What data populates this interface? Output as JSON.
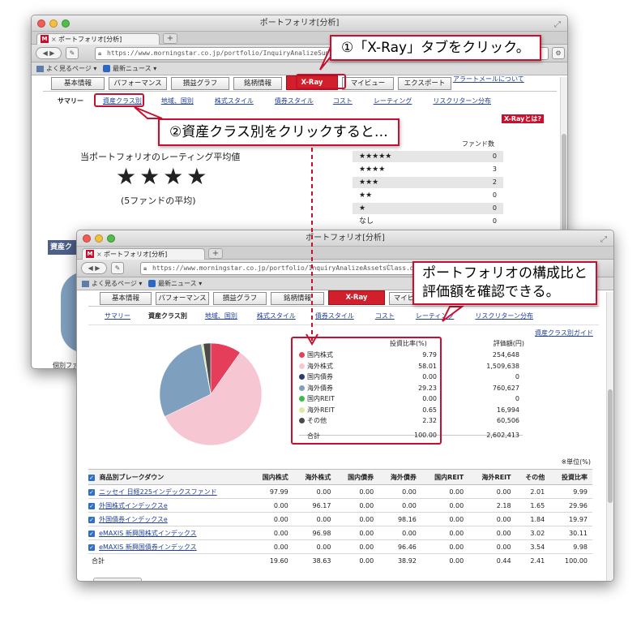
{
  "back_window": {
    "title": "ポートフォリオ[分析]",
    "tab_label": "ポートフォリオ[分析]",
    "url": "https://www.morningstar.co.jp/portfolio/InquiryAnalizeSummary.do",
    "bookmarks": [
      "よく見るページ ▾",
      "最新ニュース ▾"
    ],
    "main_tabs": [
      "基本情報",
      "パフォーマンス",
      "損益グラフ",
      "銘柄情報",
      "X-Ray",
      "マイビュー",
      "エクスポート"
    ],
    "alert_link": "アラートメールについて",
    "sub_tabs": [
      "サマリー",
      "資産クラス別",
      "地域、国別",
      "株式スタイル",
      "債券スタイル",
      "コスト",
      "レーティング",
      "リスクリターン分布"
    ],
    "xray_help": "X-Rayとは?",
    "rating_title": "当ポートフォリオのレーティング平均値",
    "rating_stars": "★★★★",
    "rating_note": "(5ファンドの平均)",
    "fund_count_header": "ファンド数",
    "rating_rows": [
      {
        "stars": "★★★★★",
        "count": "0"
      },
      {
        "stars": "★★★★",
        "count": "3"
      },
      {
        "stars": "★★★",
        "count": "2"
      },
      {
        "stars": "★★",
        "count": "0"
      },
      {
        "stars": "★",
        "count": "0"
      },
      {
        "stars": "なし",
        "count": "0"
      }
    ],
    "side_label_1": "資産ク",
    "side_label_2": "個別ファ"
  },
  "front_window": {
    "title": "ポートフォリオ[分析]",
    "tab_label": "ポートフォリオ[分析]",
    "url": "https://www.morningstar.co.jp/portfolio/InquiryAnalizeAssetsClass.do",
    "bookmarks": [
      "よく見るページ ▾",
      "最新ニュース ▾"
    ],
    "main_tabs": [
      "基本情報",
      "パフォーマンス",
      "損益グラフ",
      "銘柄情報",
      "X-Ray",
      "マイビュー"
    ],
    "sub_tabs": [
      "サマリー",
      "資産クラス別",
      "地域、国別",
      "株式スタイル",
      "債券スタイル",
      "コスト",
      "レーティング",
      "リスクリターン分布"
    ],
    "guide_link": "資産クラス別ガイド",
    "legend_headers": [
      "投資比率(%)",
      "評価額(円)"
    ],
    "legend_rows": [
      {
        "label": "国内株式",
        "ratio": "9.79",
        "amount": "254,648",
        "color": "#e53e5a"
      },
      {
        "label": "海外株式",
        "ratio": "58.01",
        "amount": "1,509,638",
        "color": "#f6c7d3"
      },
      {
        "label": "国内債券",
        "ratio": "0.00",
        "amount": "0",
        "color": "#2d3a73"
      },
      {
        "label": "海外債券",
        "ratio": "29.23",
        "amount": "760,627",
        "color": "#7f9fbe"
      },
      {
        "label": "国内REIT",
        "ratio": "0.00",
        "amount": "0",
        "color": "#3dbb4a"
      },
      {
        "label": "海外REIT",
        "ratio": "0.65",
        "amount": "16,994",
        "color": "#dde8a0"
      },
      {
        "label": "その他",
        "ratio": "2.32",
        "amount": "60,506",
        "color": "#4a4a4a"
      }
    ],
    "legend_total": {
      "label": "合計",
      "ratio": "100.00",
      "amount": "2,602,413"
    },
    "unit_note": "※単位(%)",
    "breakdown_headers": [
      "商品別ブレークダウン",
      "国内株式",
      "海外株式",
      "国内債券",
      "海外債券",
      "国内REIT",
      "海外REIT",
      "その他",
      "投資比率"
    ],
    "breakdown_rows": [
      {
        "name": "ニッセイ 日経225インデックスファンド",
        "values": [
          "97.99",
          "0.00",
          "0.00",
          "0.00",
          "0.00",
          "0.00",
          "2.01",
          "9.99"
        ]
      },
      {
        "name": "外国株式インデックスe",
        "values": [
          "0.00",
          "96.17",
          "0.00",
          "0.00",
          "0.00",
          "2.18",
          "1.65",
          "29.96"
        ]
      },
      {
        "name": "外国債券インデックスe",
        "values": [
          "0.00",
          "0.00",
          "0.00",
          "98.16",
          "0.00",
          "0.00",
          "1.84",
          "19.97"
        ]
      },
      {
        "name": "eMAXIS 新興国株式インデックス",
        "values": [
          "0.00",
          "96.98",
          "0.00",
          "0.00",
          "0.00",
          "0.00",
          "3.02",
          "30.11"
        ]
      },
      {
        "name": "eMAXIS 新興国債券インデックス",
        "values": [
          "0.00",
          "0.00",
          "0.00",
          "96.46",
          "0.00",
          "0.00",
          "3.54",
          "9.98"
        ]
      }
    ],
    "breakdown_total": {
      "name": "合計",
      "values": [
        "19.60",
        "38.63",
        "0.00",
        "38.92",
        "0.00",
        "0.44",
        "2.41",
        "100.00"
      ]
    }
  },
  "callouts": {
    "step1": "①「X-Ray」タブをクリック。",
    "step2": "②資産クラス別をクリックすると…",
    "result_line1": "ポートフォリオの構成比と",
    "result_line2": "評価額を確認できる。"
  },
  "chart_data": {
    "type": "pie",
    "categories": [
      "国内株式",
      "海外株式",
      "国内債券",
      "海外債券",
      "国内REIT",
      "海外REIT",
      "その他"
    ],
    "values": [
      9.79,
      58.01,
      0.0,
      29.23,
      0.0,
      0.65,
      2.32
    ],
    "colors": [
      "#e53e5a",
      "#f6c7d3",
      "#2d3a73",
      "#7f9fbe",
      "#3dbb4a",
      "#dde8a0",
      "#4a4a4a"
    ]
  }
}
